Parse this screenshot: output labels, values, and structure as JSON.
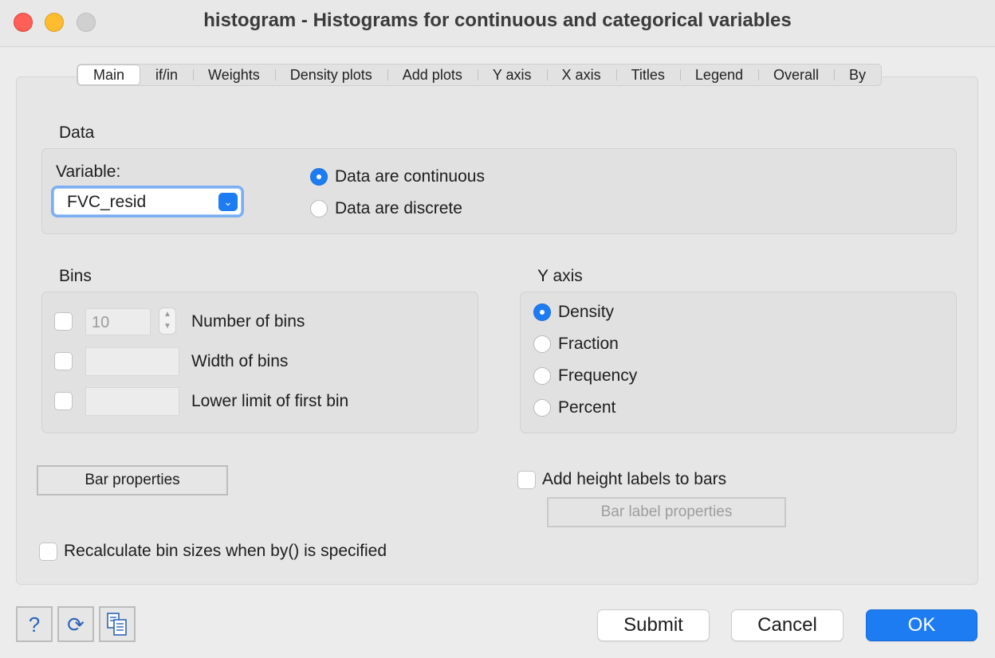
{
  "window": {
    "title": "histogram - Histograms for continuous and categorical variables"
  },
  "tabs": [
    {
      "label": "Main",
      "active": true
    },
    {
      "label": "if/in"
    },
    {
      "label": "Weights"
    },
    {
      "label": "Density plots"
    },
    {
      "label": "Add plots"
    },
    {
      "label": "Y axis"
    },
    {
      "label": "X axis"
    },
    {
      "label": "Titles"
    },
    {
      "label": "Legend"
    },
    {
      "label": "Overall"
    },
    {
      "label": "By"
    }
  ],
  "data_section": {
    "label": "Data",
    "variable_label": "Variable:",
    "variable_value": "FVC_resid",
    "continuous_label": "Data are continuous",
    "discrete_label": "Data are discrete",
    "selected": "continuous"
  },
  "bins": {
    "label": "Bins",
    "num_bins_value": "10",
    "num_bins_label": "Number of bins",
    "width_label": "Width of bins",
    "lower_label": "Lower limit of first bin"
  },
  "yaxis": {
    "label": "Y axis",
    "options": [
      "Density",
      "Fraction",
      "Frequency",
      "Percent"
    ],
    "selected": "Density"
  },
  "bar_properties_label": "Bar properties",
  "height_labels_label": "Add height labels to bars",
  "bar_label_properties_label": "Bar label properties",
  "recalc_label": "Recalculate bin sizes when by() is specified",
  "footer": {
    "submit": "Submit",
    "cancel": "Cancel",
    "ok": "OK",
    "help_glyph": "?",
    "reset_glyph": "⟳"
  },
  "colors": {
    "accent": "#1e7cf3",
    "close": "#fe5f57",
    "minimize": "#febc2e"
  }
}
